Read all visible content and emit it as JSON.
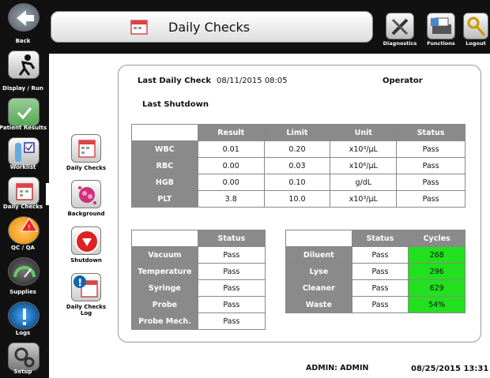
{
  "header": {
    "title": "Daily Checks"
  },
  "top_buttons": [
    {
      "label": "Diagnostics",
      "icon": "wrench-screwdriver-icon"
    },
    {
      "label": "Functions",
      "icon": "printer-icon"
    },
    {
      "label": "Logout",
      "icon": "key-icon"
    }
  ],
  "sidebar": {
    "items": [
      {
        "label": "Back",
        "icon": "back-arrow-icon"
      },
      {
        "label": "Display / Run",
        "icon": "runner-icon"
      },
      {
        "label": "Patient Results",
        "icon": "results-check-icon"
      },
      {
        "label": "Worklist",
        "icon": "worklist-icon"
      },
      {
        "label": "Daily Checks",
        "icon": "calendar-icon"
      },
      {
        "label": "QC / QA",
        "icon": "qc-warning-icon"
      },
      {
        "label": "Supplies",
        "icon": "gauge-icon"
      },
      {
        "label": "Logs",
        "icon": "info-icon"
      },
      {
        "label": "Setup",
        "icon": "gears-icon"
      }
    ]
  },
  "tools": [
    {
      "label": "Daily Checks",
      "icon": "calendar-icon"
    },
    {
      "label": "Background",
      "icon": "cells-icon"
    },
    {
      "label": "Shutdown",
      "icon": "shutdown-icon"
    },
    {
      "label": "Daily Checks Log",
      "icon": "calendar-info-icon"
    }
  ],
  "panel": {
    "last_daily_check_label": "Last Daily Check",
    "last_daily_check_value": "08/11/2015 08:05",
    "operator_label": "Operator",
    "last_shutdown_label": "Last Shutdown"
  },
  "results_table": {
    "headers": [
      "Result",
      "Limit",
      "Unit",
      "Status"
    ],
    "rows": [
      {
        "name": "WBC",
        "result": "0.01",
        "limit": "0.20",
        "unit": "x10³/µL",
        "status": "Pass"
      },
      {
        "name": "RBC",
        "result": "0.00",
        "limit": "0.03",
        "unit": "x10⁶/µL",
        "status": "Pass"
      },
      {
        "name": "HGB",
        "result": "0.00",
        "limit": "0.10",
        "unit": "g/dL",
        "status": "Pass"
      },
      {
        "name": "PLT",
        "result": "3.8",
        "limit": "10.0",
        "unit": "x10³/µL",
        "status": "Pass"
      }
    ]
  },
  "system_table": {
    "header": "Status",
    "rows": [
      {
        "name": "Vacuum",
        "status": "Pass"
      },
      {
        "name": "Temperature",
        "status": "Pass"
      },
      {
        "name": "Syringe",
        "status": "Pass"
      },
      {
        "name": "Probe",
        "status": "Pass"
      },
      {
        "name": "Probe Mech.",
        "status": "Pass"
      }
    ]
  },
  "reagent_table": {
    "headers": [
      "Status",
      "Cycles"
    ],
    "rows": [
      {
        "name": "Diluent",
        "status": "Pass",
        "cycles": "268"
      },
      {
        "name": "Lyse",
        "status": "Pass",
        "cycles": "296"
      },
      {
        "name": "Cleaner",
        "status": "Pass",
        "cycles": "629"
      },
      {
        "name": "Waste",
        "status": "Pass",
        "cycles": "54%"
      }
    ]
  },
  "footer": {
    "user": "ADMIN: ADMIN",
    "datetime": "08/25/2015 13:31"
  },
  "colors": {
    "header_gray": "#8a8a8a",
    "pass_green": "#23e01e",
    "chrome_black": "#111111"
  }
}
